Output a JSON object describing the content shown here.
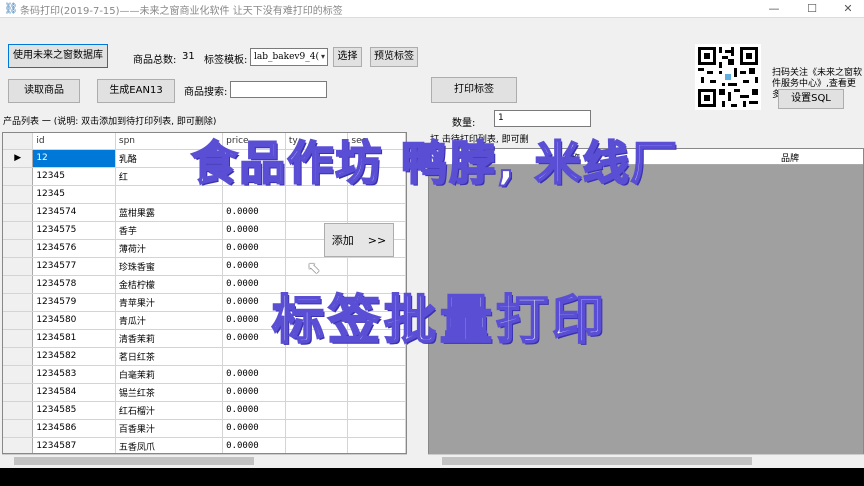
{
  "window": {
    "title": "条码打印(2019-7-15)——未来之窗商业化软件   让天下没有难打印的标签",
    "minimize": "—",
    "maximize": "☐",
    "close": "✕"
  },
  "toolbar": {
    "use_db_label": "使用未来之窗数据库",
    "total_label": "商品总数:",
    "total_value": "31",
    "template_label": "标签模板:",
    "template_value": "lab_bakev9_4(",
    "select_label": "选择",
    "preview_label": "预览标签",
    "read_goods_label": "读取商品",
    "gen_ean13_label": "生成EAN13",
    "search_label": "商品搜索:",
    "search_value": "",
    "print_label": "打印标签",
    "qty_label": "数量:",
    "qty_value": "1",
    "set_sql_label": "设置SQL",
    "follow_note": "扫码关注《未来之窗软件服务中心》,查看更多帮助信息"
  },
  "product_list": {
    "caption": "产品列表 一 (说明: 双击添加到待打印列表, 即可删除)",
    "columns": [
      "id",
      "spn",
      "price",
      "ty",
      "sec"
    ],
    "rows": [
      {
        "id": "12",
        "name": "乳酪",
        "price": ""
      },
      {
        "id": "12345",
        "name": "红",
        "price": ""
      },
      {
        "id": "12345",
        "name": "",
        "price": ""
      },
      {
        "id": "1234574",
        "name": "蓝柑果露",
        "price": "0.0000"
      },
      {
        "id": "1234575",
        "name": "香芋",
        "price": "0.0000"
      },
      {
        "id": "1234576",
        "name": "薄荷汁",
        "price": "0.0000"
      },
      {
        "id": "1234577",
        "name": "珍珠香蜜",
        "price": "0.0000"
      },
      {
        "id": "1234578",
        "name": "金桔柠檬",
        "price": "0.0000"
      },
      {
        "id": "1234579",
        "name": "青苹果汁",
        "price": "0.0000"
      },
      {
        "id": "1234580",
        "name": "青瓜汁",
        "price": "0.0000"
      },
      {
        "id": "1234581",
        "name": "清香茉莉",
        "price": "0.0000"
      },
      {
        "id": "1234582",
        "name": "茗日红茶",
        "price": ""
      },
      {
        "id": "1234583",
        "name": "白毫茉莉",
        "price": "0.0000"
      },
      {
        "id": "1234584",
        "name": "锡兰红茶",
        "price": "0.0000"
      },
      {
        "id": "1234585",
        "name": "红石榴汁",
        "price": "0.0000"
      },
      {
        "id": "1234586",
        "name": "百香果汁",
        "price": "0.0000"
      },
      {
        "id": "1234587",
        "name": "五香凤爪",
        "price": "0.0000"
      }
    ]
  },
  "add_button": {
    "label": "添加",
    "arrow": ">>"
  },
  "print_list": {
    "caption": "打        击待打印列表, 即可删",
    "columns": [
      "商品名称",
      "品牌"
    ]
  },
  "overlay": {
    "line1": "食品作坊 鸭脖, 米线厂",
    "line2": "标签批量打印"
  }
}
